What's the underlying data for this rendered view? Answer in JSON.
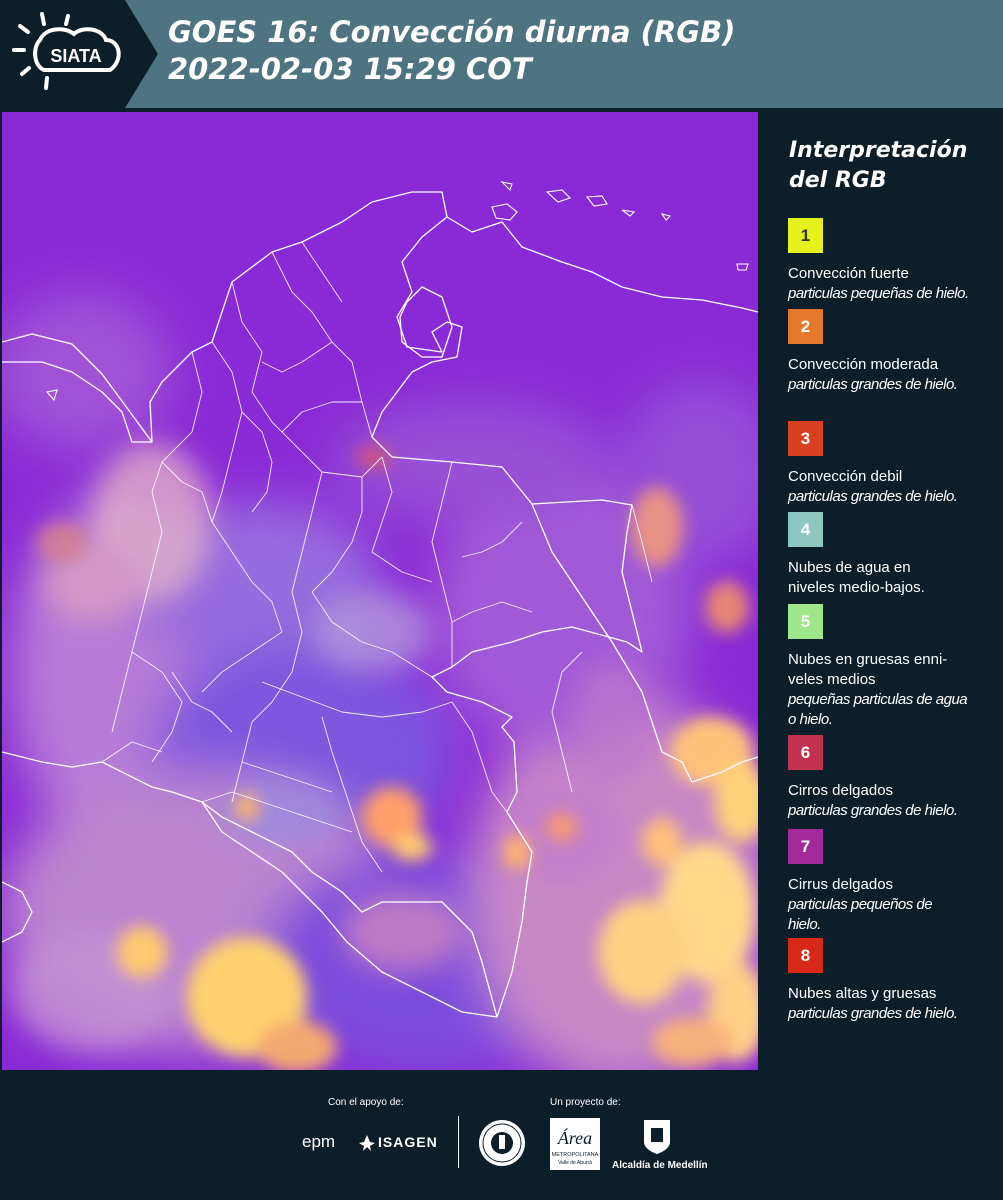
{
  "header": {
    "logo_text": "SIATA",
    "title_line1": "GOES 16: Convección diurna (RGB)",
    "title_line2": " 2022-02-03 15:29 COT",
    "background_color": "#4e7482"
  },
  "map": {
    "base_color": "#8a2ad6",
    "border_color": "#ffffff"
  },
  "legend": {
    "title_line1": "Interpretación",
    "title_line2": "del RGB",
    "items": [
      {
        "number": "1",
        "color": "#e7f11c",
        "label": "Convección fuerte",
        "sub": "particulas pequeñas de hielo."
      },
      {
        "number": "2",
        "color": "#e4782b",
        "label": "Convección moderada",
        "sub": "particulas grandes de hielo."
      },
      {
        "number": "3",
        "color": "#d8401f",
        "label": "Convección debil",
        "sub": "particulas grandes de hielo."
      },
      {
        "number": "4",
        "color": "#8ec6c0",
        "label": "Nubes de agua en niveles medio-bajos.",
        "sub": ""
      },
      {
        "number": "5",
        "color": "#9fe58a",
        "label": "Nubes en gruesas enni-veles medios",
        "sub": "pequeñas particulas de agua o hielo."
      },
      {
        "number": "6",
        "color": "#c0324f",
        "label": "Cirros delgados",
        "sub": "particulas grandes de hielo."
      },
      {
        "number": "7",
        "color": "#a12b9a",
        "label": "Cirrus delgados",
        "sub": "particulas pequeños de hielo."
      },
      {
        "number": "8",
        "color": "#d82819",
        "label": "Nubes altas y gruesas",
        "sub": "particulas grandes de hielo."
      }
    ]
  },
  "footer": {
    "support_label": "Con el apoyo de:",
    "project_label": "Un proyecto de:",
    "sponsor1": "epm",
    "sponsor2": "ISAGEN",
    "area_name": "Área",
    "area_sub": "METROPOLITANA",
    "area_sub2": "Valle de Aburrá",
    "alcaldia": "Alcaldía de Medellín"
  }
}
